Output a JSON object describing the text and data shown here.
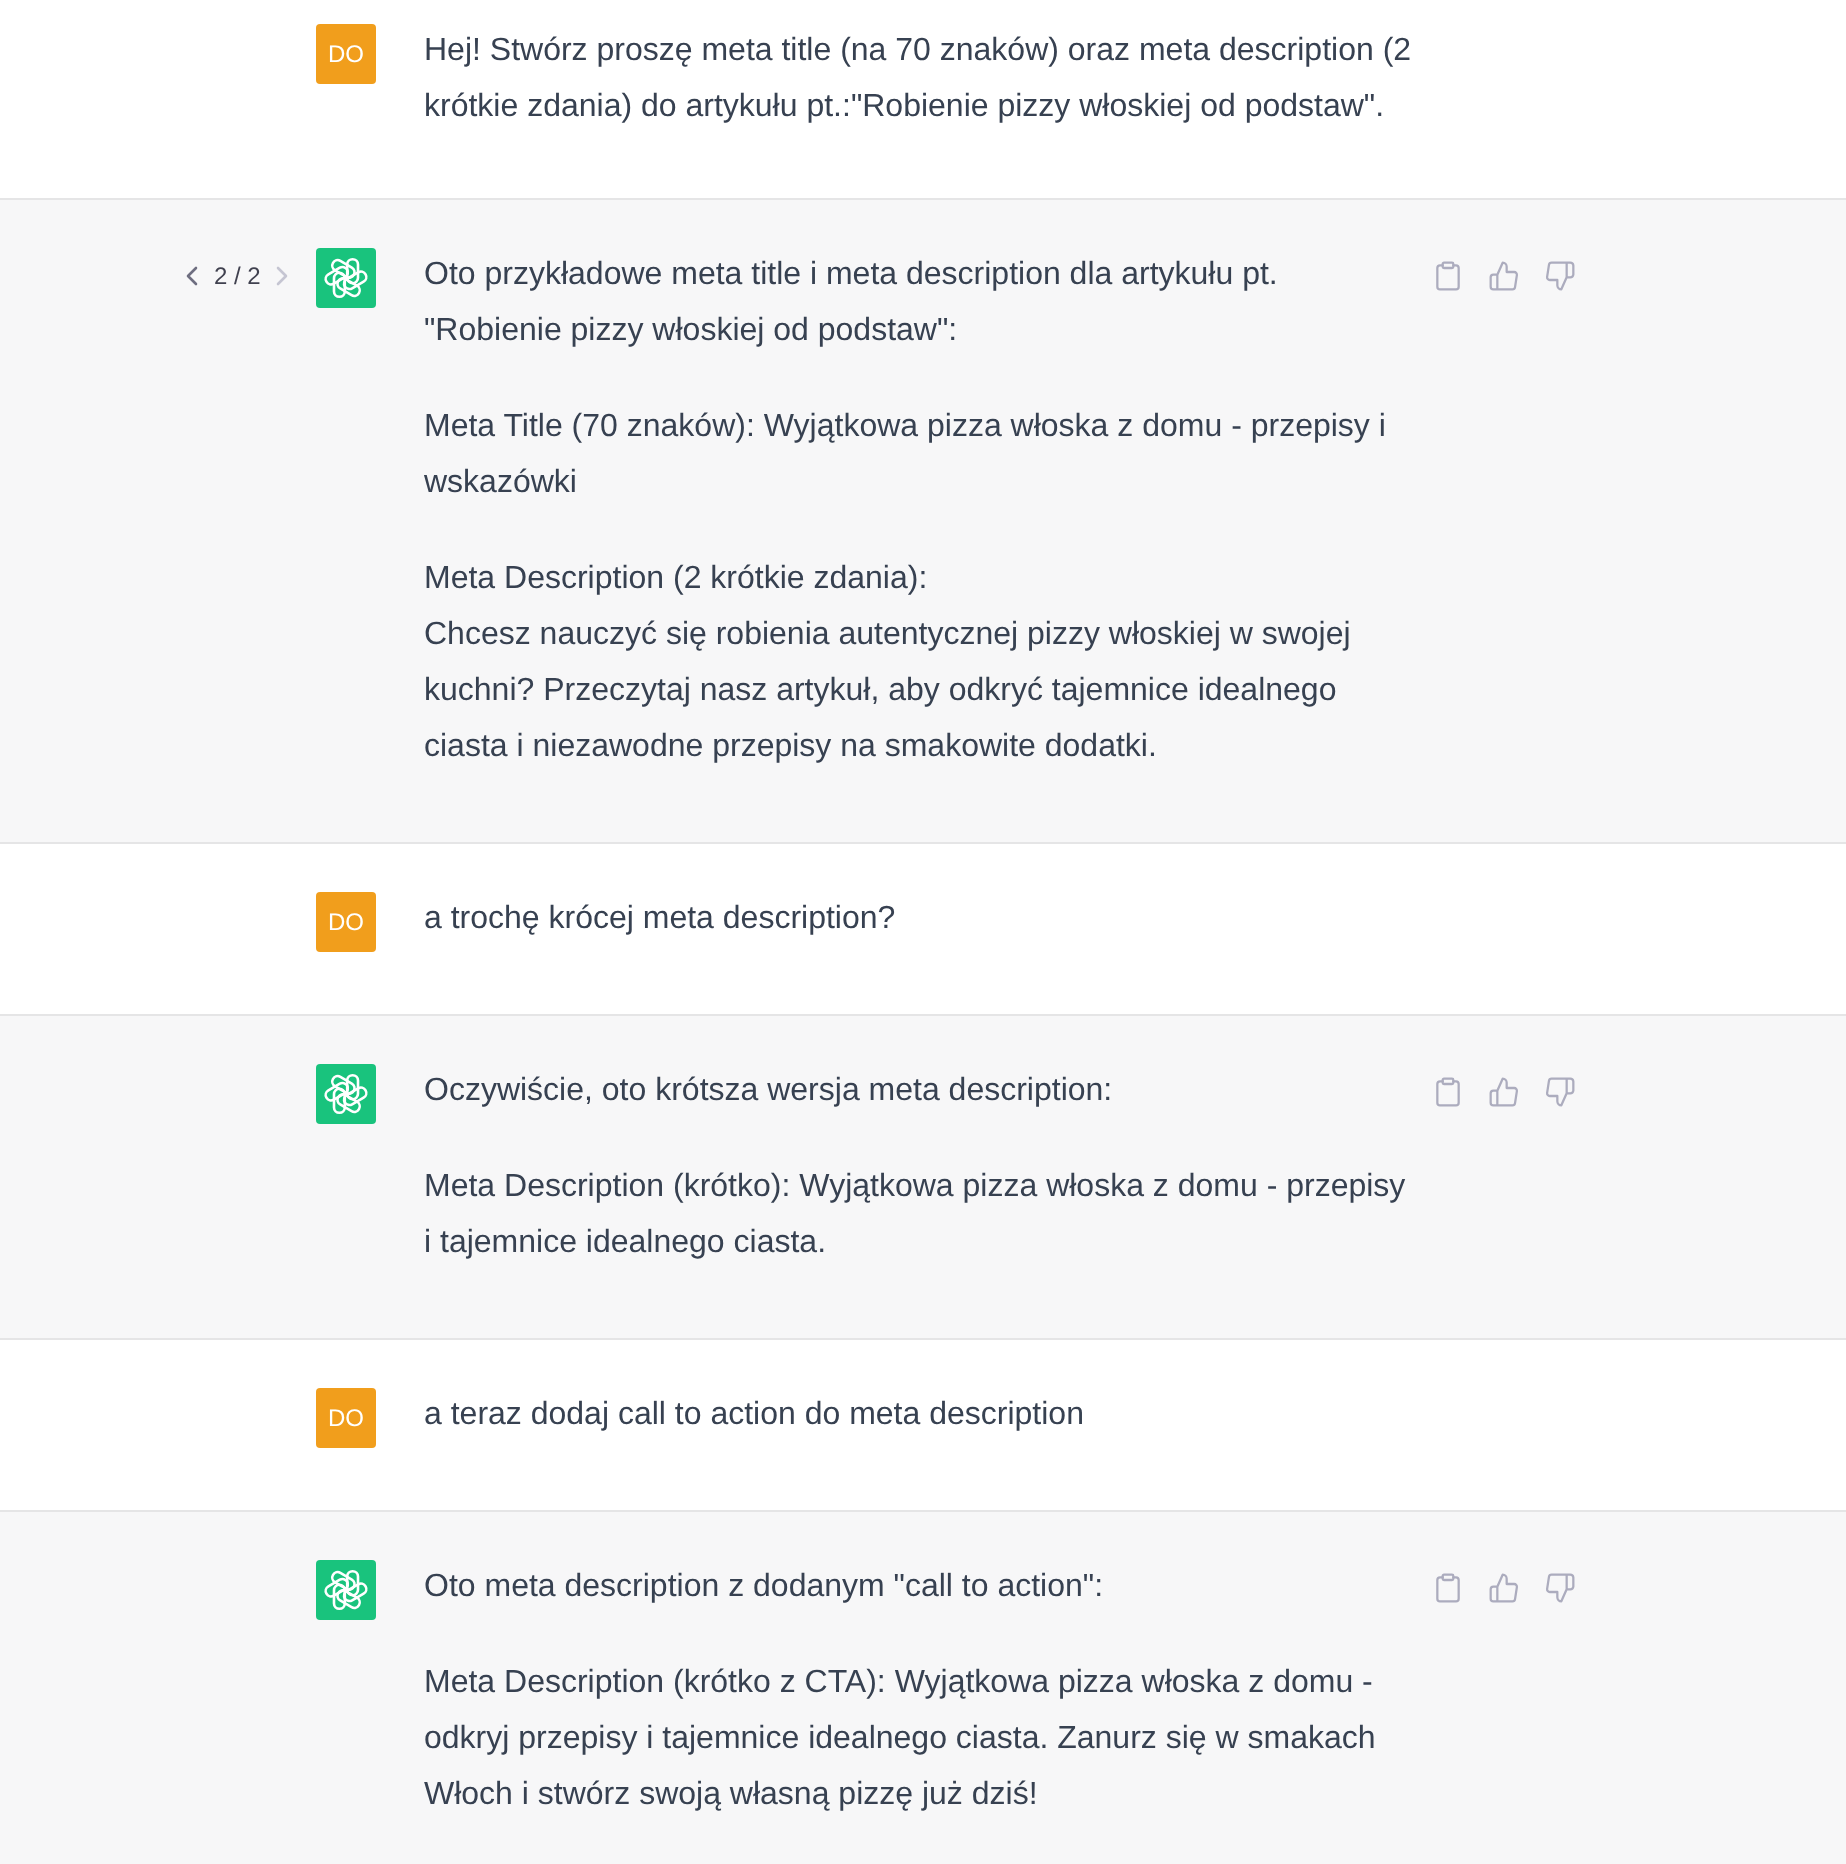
{
  "messages": [
    {
      "kind": "user",
      "avatar": "DO",
      "paragraphs": [
        "Hej! Stwórz proszę meta title (na 70 znaków) oraz meta description (2 krótkie zdania) do artykułu pt.:\"Robienie pizzy włoskiej od podstaw\"."
      ]
    },
    {
      "kind": "assistant",
      "pager": {
        "label": "2 / 2",
        "previous": {
          "disabled": false
        },
        "next": {
          "disabled": true
        }
      },
      "paragraphs": [
        "Oto przykładowe meta title i meta description dla artykułu pt. \"Robienie pizzy włoskiej od podstaw\":",
        "Meta Title (70 znaków): Wyjątkowa pizza włoska z domu - przepisy i wskazówki",
        "Meta Description (2 krótkie zdania):\nChcesz nauczyć się robienia autentycznej pizzy włoskiej w swojej kuchni? Przeczytaj nasz artykuł, aby odkryć tajemnice idealnego ciasta i niezawodne przepisy na smakowite dodatki."
      ]
    },
    {
      "kind": "user",
      "avatar": "DO",
      "paragraphs": [
        "a trochę krócej meta description?"
      ]
    },
    {
      "kind": "assistant",
      "paragraphs": [
        "Oczywiście, oto krótsza wersja meta description:",
        "Meta Description (krótko): Wyjątkowa pizza włoska z domu - przepisy i tajemnice idealnego ciasta."
      ]
    },
    {
      "kind": "user",
      "avatar": "DO",
      "paragraphs": [
        "a teraz dodaj call to action do meta description"
      ]
    },
    {
      "kind": "assistant",
      "paragraphs": [
        "Oto meta description z dodanym \"call to action\":",
        "Meta Description (krótko z CTA): Wyjątkowa pizza włoska z domu - odkryj przepisy i tajemnice idealnego ciasta. Zanurz się w smakach Włoch i stwórz swoją własną pizzę już dziś!"
      ]
    }
  ]
}
